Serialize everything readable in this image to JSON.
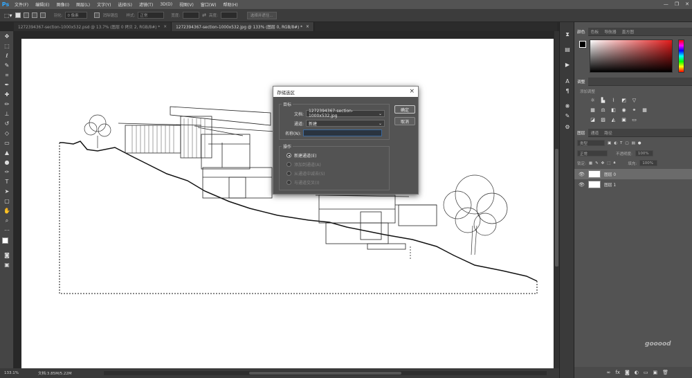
{
  "app": {
    "logo": "Ps"
  },
  "menu": [
    "文件(F)",
    "编辑(E)",
    "图像(I)",
    "图层(L)",
    "文字(Y)",
    "选择(S)",
    "滤镜(T)",
    "3D(D)",
    "视图(V)",
    "窗口(W)",
    "帮助(H)"
  ],
  "options": {
    "feather_label": "羽化:",
    "feather_value": "0 像素",
    "antialias_label": "消除锯齿",
    "style_label": "样式:",
    "style_value": "正常",
    "width_label": "宽度:",
    "height_label": "高度:",
    "select_mask_label": "选择并遮住..."
  },
  "tabs": [
    {
      "label": "1272394367-section-1000x532.psd @ 13.7% (图层 0 拷贝 2, RGB/8#) *",
      "active": false
    },
    {
      "label": "1272394367-section-1000x532.jpg @ 133% (图层 0, RGB/8#) *",
      "active": true
    }
  ],
  "status": {
    "zoom": "133.1%",
    "doc_info": "文档:3.85M/5.22M"
  },
  "panels": {
    "color_tabs": [
      "颜色",
      "色板",
      "导航器",
      "直方图"
    ],
    "adjust_tabs": [
      "调整"
    ],
    "adjust_add_label": "添加调整",
    "layers_tabs": [
      "图层",
      "通道",
      "路径"
    ],
    "kind_label": "类型",
    "blend_mode": "正常",
    "opacity_label": "不透明度:",
    "opacity_value": "100%",
    "lock_label": "锁定:",
    "fill_label": "填充:",
    "fill_value": "100%",
    "layers": [
      {
        "name": "图层 0",
        "selected": true
      },
      {
        "name": "图层 1",
        "selected": false
      }
    ]
  },
  "dialog": {
    "title": "存储选区",
    "target_legend": "目标",
    "document_label": "文档:",
    "document_value": "1272394367-section-1000x532.jpg",
    "channel_label": "通道:",
    "channel_value": "新建",
    "name_label": "名称(N):",
    "name_value": "",
    "operation_legend": "操作",
    "ops": [
      {
        "label": "新建通道(E)",
        "checked": true,
        "enabled": true
      },
      {
        "label": "添加到通道(A)",
        "checked": false,
        "enabled": false
      },
      {
        "label": "从通道中减去(S)",
        "checked": false,
        "enabled": false
      },
      {
        "label": "与通道交叉(I)",
        "checked": false,
        "enabled": false
      }
    ],
    "ok_label": "确定",
    "cancel_label": "取消"
  },
  "watermark": "gooood"
}
